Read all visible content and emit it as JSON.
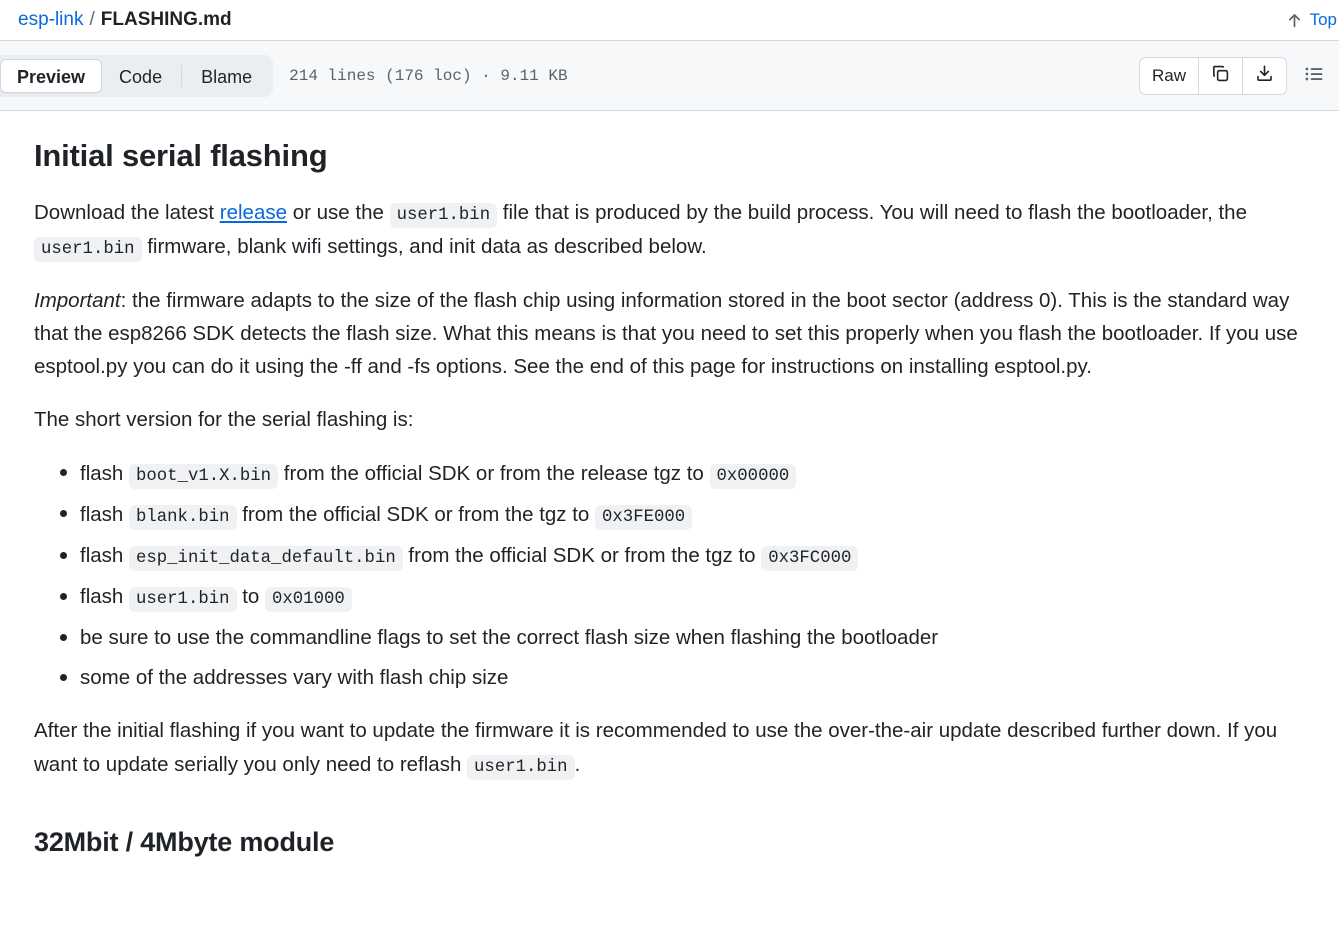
{
  "breadcrumb": {
    "repo": "esp-link",
    "separator": "/",
    "file": "FLASHING.md"
  },
  "top_link": {
    "label": "Top",
    "icon": "arrow-up-icon"
  },
  "toolbar": {
    "tabs": [
      {
        "label": "Preview",
        "active": true
      },
      {
        "label": "Code",
        "active": false
      },
      {
        "label": "Blame",
        "active": false
      }
    ],
    "file_meta": "214 lines (176 loc) · 9.11 KB",
    "raw_label": "Raw",
    "copy_icon": "copy-icon",
    "download_icon": "download-icon",
    "outline_icon": "outline-icon"
  },
  "content": {
    "h1": "Initial serial flashing",
    "p1": {
      "a": "Download the latest ",
      "link": "release",
      "b": " or use the ",
      "code1": "user1.bin",
      "c": " file that is produced by the build process. You will need to flash the bootloader, the ",
      "code2": "user1.bin",
      "d": " firmware, blank wifi settings, and init data as described below."
    },
    "p2": {
      "em": "Important",
      "rest": ": the firmware adapts to the size of the flash chip using information stored in the boot sector (address 0). This is the standard way that the esp8266 SDK detects the flash size. What this means is that you need to set this properly when you flash the bootloader. If you use esptool.py you can do it using the -ff and -fs options. See the end of this page for instructions on installing esptool.py."
    },
    "p3": "The short version for the serial flashing is:",
    "list": [
      {
        "a": "flash ",
        "code1": "boot_v1.X.bin",
        "b": " from the official SDK or from the release tgz to ",
        "code2": "0x00000",
        "c": ""
      },
      {
        "a": "flash ",
        "code1": "blank.bin",
        "b": " from the official SDK or from the tgz to ",
        "code2": "0x3FE000",
        "c": ""
      },
      {
        "a": "flash ",
        "code1": "esp_init_data_default.bin",
        "b": " from the official SDK or from the tgz to ",
        "code2": "0x3FC000",
        "c": ""
      },
      {
        "a": "flash ",
        "code1": "user1.bin",
        "b": " to ",
        "code2": "0x01000",
        "c": ""
      },
      {
        "a": "be sure to use the commandline flags to set the correct flash size when flashing the bootloader",
        "code1": "",
        "b": "",
        "code2": "",
        "c": ""
      },
      {
        "a": "some of the addresses vary with flash chip size",
        "code1": "",
        "b": "",
        "code2": "",
        "c": ""
      }
    ],
    "p4": {
      "a": "After the initial flashing if you want to update the firmware it is recommended to use the over-the-air update described further down. If you want to update serially you only need to reflash ",
      "code1": "user1.bin",
      "b": "."
    },
    "h2": "32Mbit / 4Mbyte module"
  },
  "colors": {
    "link": "#0969da",
    "toolbar_bg": "#f6f8fa",
    "border": "#d1d9e0",
    "code_bg": "#eff1f3",
    "text": "#1f2328",
    "muted": "#59636e"
  }
}
